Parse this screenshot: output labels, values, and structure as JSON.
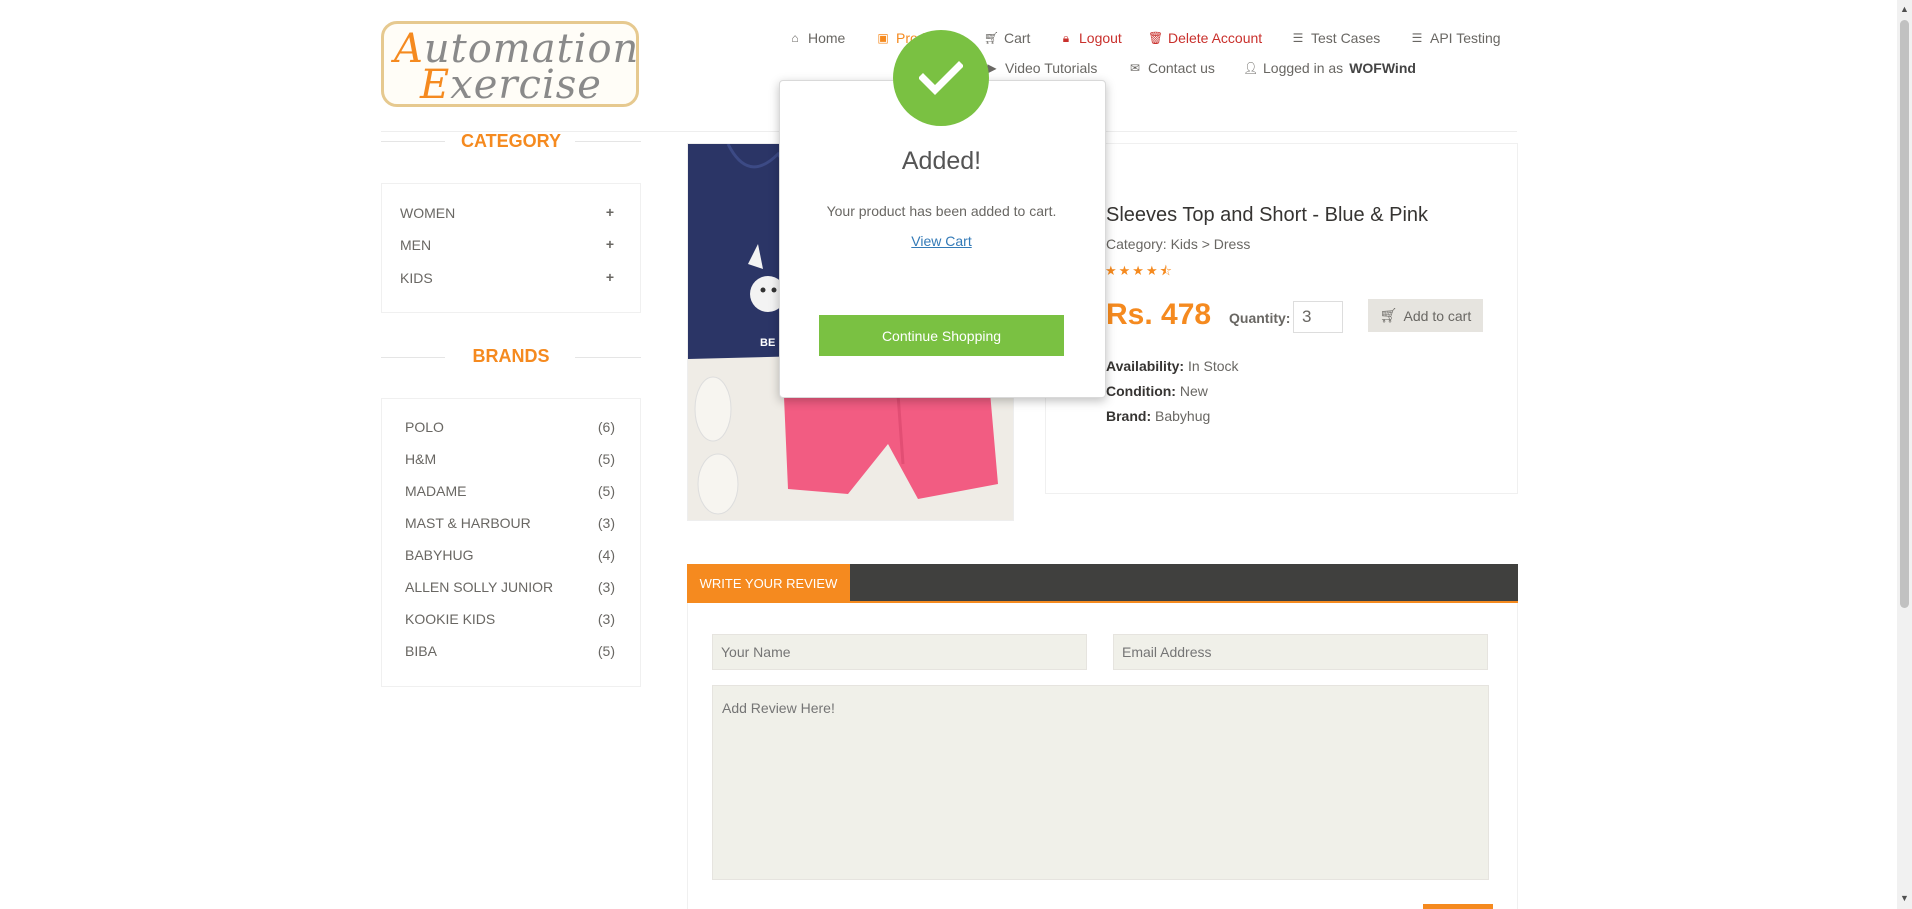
{
  "logo": {
    "line1_cap": "A",
    "line1_rest": "utomation",
    "line2_cap": "E",
    "line2_rest": "xercise"
  },
  "nav": {
    "home": "Home",
    "products": "Products",
    "cart": "Cart",
    "logout": "Logout",
    "delete_account": "Delete Account",
    "test_cases": "Test Cases",
    "api_testing": "API Testing",
    "video_tutorials": "Video Tutorials",
    "contact_us": "Contact us",
    "logged_in_prefix": "Logged in as",
    "username": "WOFWind"
  },
  "sidebar": {
    "category_title": "CATEGORY",
    "categories": [
      {
        "label": "WOMEN",
        "icon": "+"
      },
      {
        "label": "MEN",
        "icon": "+"
      },
      {
        "label": "KIDS",
        "icon": "+"
      }
    ],
    "brands_title": "BRANDS",
    "brands": [
      {
        "name": "POLO",
        "count": "(6)"
      },
      {
        "name": "H&M",
        "count": "(5)"
      },
      {
        "name": "MADAME",
        "count": "(5)"
      },
      {
        "name": "MAST & HARBOUR",
        "count": "(3)"
      },
      {
        "name": "BABYHUG",
        "count": "(4)"
      },
      {
        "name": "ALLEN SOLLY JUNIOR",
        "count": "(3)"
      },
      {
        "name": "KOOKIE KIDS",
        "count": "(3)"
      },
      {
        "name": "BIBA",
        "count": "(5)"
      }
    ]
  },
  "product": {
    "title": "Sleeves Top and Short - Blue & Pink",
    "category": "Category: Kids > Dress",
    "rating": 4.5,
    "price": "Rs. 478",
    "quantity_label": "Quantity:",
    "quantity_value": "3",
    "add_to_cart": "Add to cart",
    "availability_label": "Availability:",
    "availability_value": " In Stock",
    "condition_label": "Condition:",
    "condition_value": " New",
    "brand_label": "Brand:",
    "brand_value": " Babyhug"
  },
  "review": {
    "tab_label": "WRITE YOUR REVIEW",
    "name_placeholder": "Your Name",
    "email_placeholder": "Email Address",
    "review_placeholder": "Add Review Here!"
  },
  "modal": {
    "title": "Added!",
    "message": "Your product has been added to cart.",
    "view_cart": "View Cart",
    "continue_button": "Continue Shopping"
  },
  "colors": {
    "accent": "#f58a1f",
    "success": "#7ac142",
    "danger": "#c9302c",
    "link": "#337ab7"
  }
}
